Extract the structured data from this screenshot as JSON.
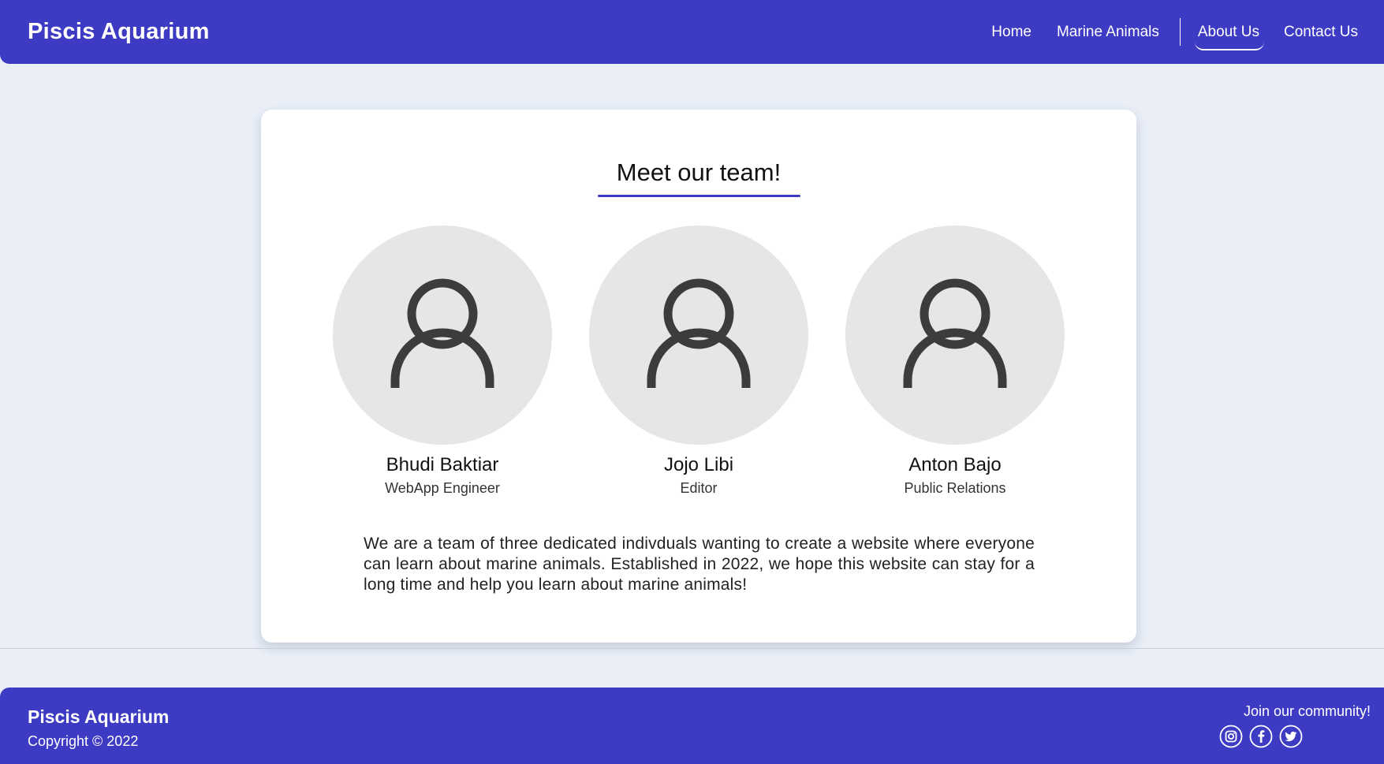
{
  "header": {
    "brand": "Piscis Aquarium",
    "nav": {
      "home": "Home",
      "marine_animals": "Marine Animals",
      "about_us": "About Us",
      "contact_us": "Contact Us"
    },
    "active_nav": "About Us"
  },
  "team": {
    "title": "Meet our team!",
    "members": [
      {
        "name": "Bhudi Baktiar",
        "role": "WebApp Engineer",
        "icon": "user-icon"
      },
      {
        "name": "Jojo Libi",
        "role": "Editor",
        "icon": "user-icon"
      },
      {
        "name": "Anton Bajo",
        "role": "Public Relations",
        "icon": "user-icon"
      }
    ],
    "description": "We are a team of three dedicated indivduals wanting to create a website where everyone can learn about marine animals. Established in 2022, we hope this website can stay for a long time and help you learn about marine animals!"
  },
  "footer": {
    "brand": "Piscis Aquarium",
    "copyright": "Copyright © 2022",
    "join_text": "Join our community!",
    "social_icons": [
      "instagram-icon",
      "facebook-icon",
      "twitter-icon"
    ]
  },
  "colors": {
    "brand": "#3d3bc3",
    "background": "#e9eef7",
    "avatar_bg": "#e6e6e6",
    "avatar_icon": "#3c3c3c"
  }
}
